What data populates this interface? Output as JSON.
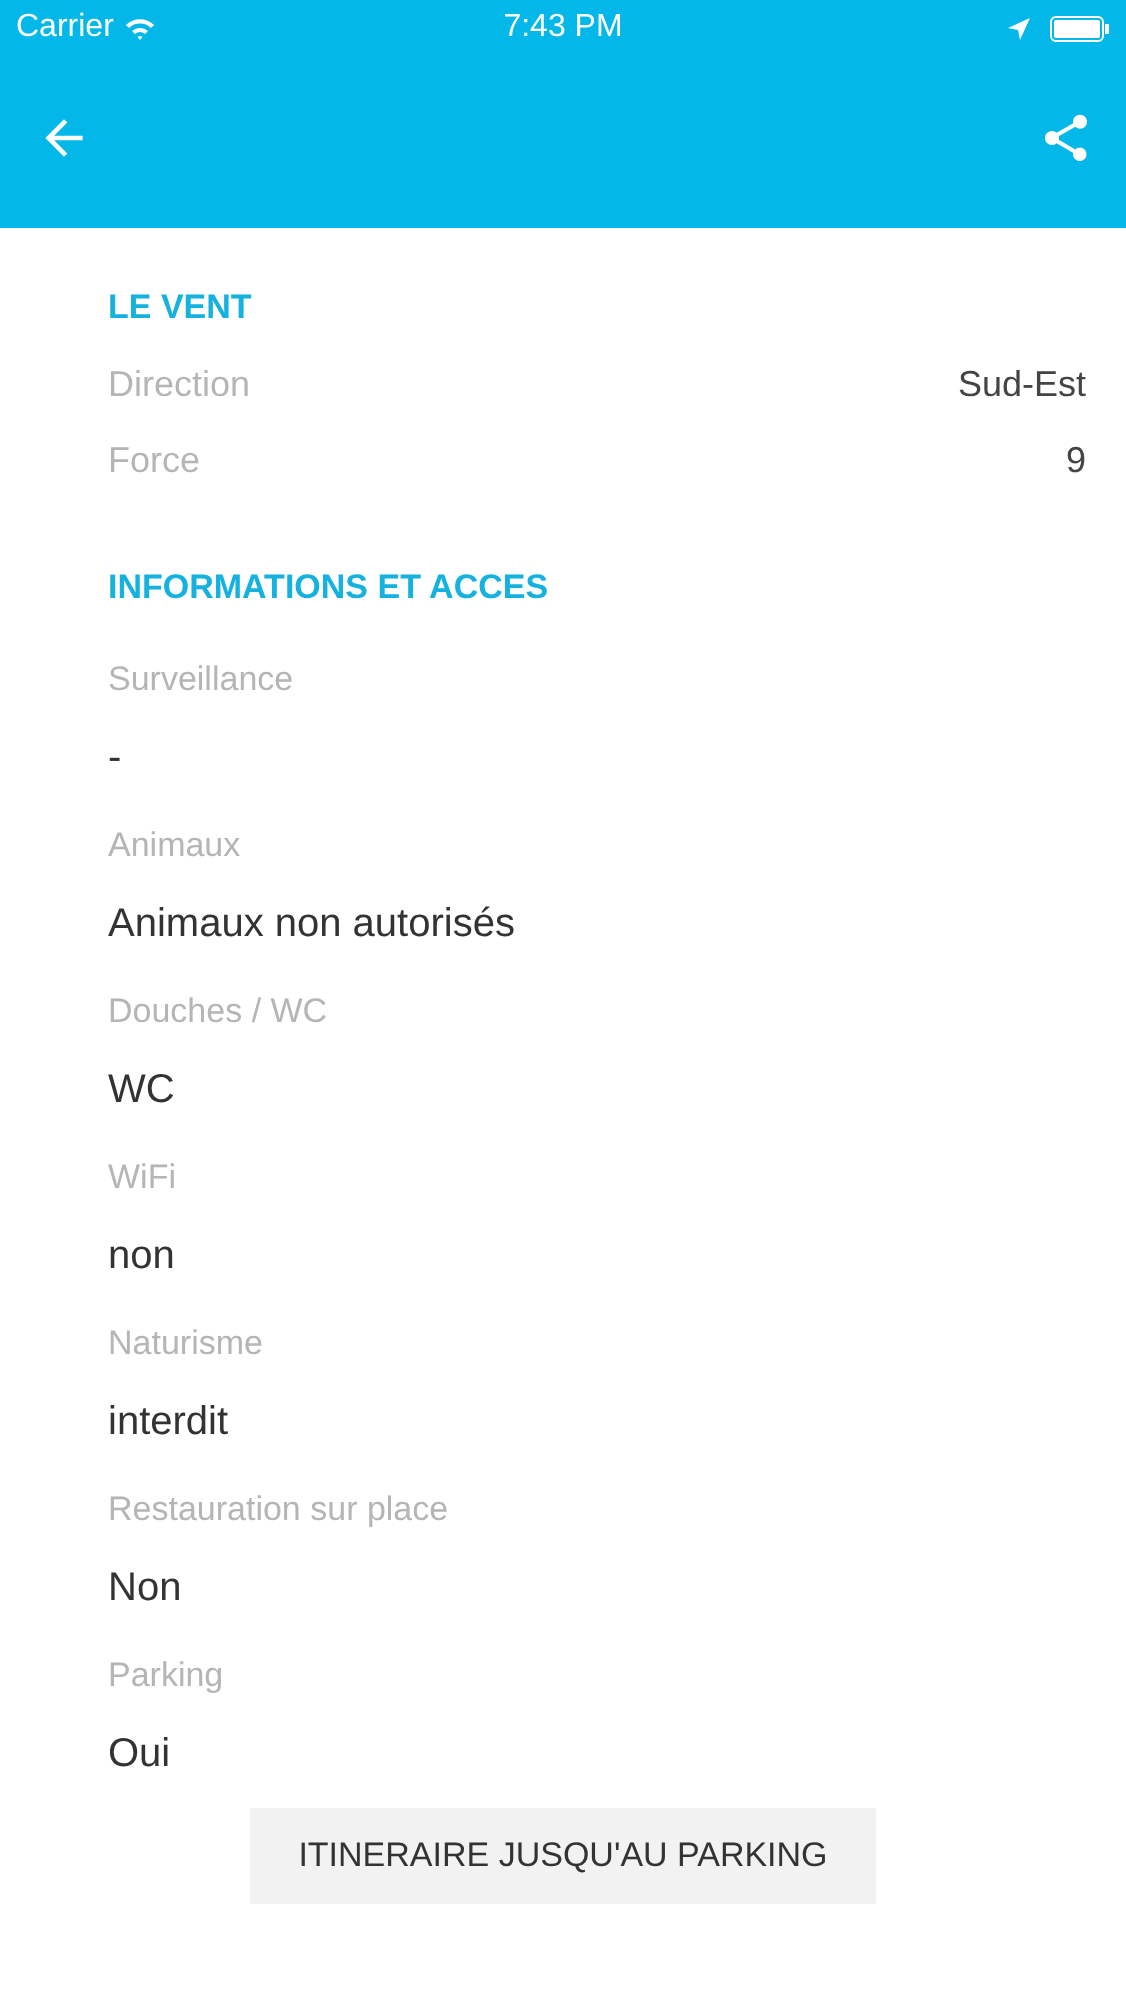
{
  "status_bar": {
    "carrier": "Carrier",
    "time": "7:43 PM"
  },
  "wind": {
    "title": "LE VENT",
    "rows": [
      {
        "label": "Direction",
        "value": "Sud-Est"
      },
      {
        "label": "Force",
        "value": "9"
      }
    ]
  },
  "info": {
    "title": "INFORMATIONS ET ACCES",
    "items": [
      {
        "label": "Surveillance",
        "value": "-"
      },
      {
        "label": "Animaux",
        "value": "Animaux non autorisés"
      },
      {
        "label": "Douches / WC",
        "value": "WC"
      },
      {
        "label": "WiFi",
        "value": "non"
      },
      {
        "label": "Naturisme",
        "value": "interdit"
      },
      {
        "label": "Restauration sur place",
        "value": "Non"
      },
      {
        "label": "Parking",
        "value": "Oui"
      }
    ]
  },
  "button": "ITINERAIRE JUSQU'AU PARKING"
}
